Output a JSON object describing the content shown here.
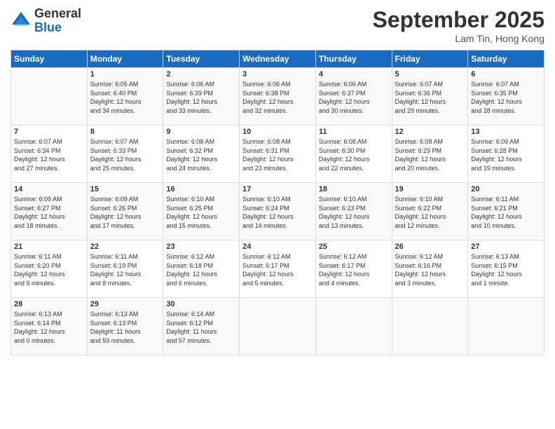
{
  "logo": {
    "general": "General",
    "blue": "Blue"
  },
  "title": "September 2025",
  "location": "Lam Tin, Hong Kong",
  "days_header": [
    "Sunday",
    "Monday",
    "Tuesday",
    "Wednesday",
    "Thursday",
    "Friday",
    "Saturday"
  ],
  "weeks": [
    [
      {
        "day": "",
        "info": ""
      },
      {
        "day": "1",
        "info": "Sunrise: 6:05 AM\nSunset: 6:40 PM\nDaylight: 12 hours\nand 34 minutes."
      },
      {
        "day": "2",
        "info": "Sunrise: 6:06 AM\nSunset: 6:39 PM\nDaylight: 12 hours\nand 33 minutes."
      },
      {
        "day": "3",
        "info": "Sunrise: 6:06 AM\nSunset: 6:38 PM\nDaylight: 12 hours\nand 32 minutes."
      },
      {
        "day": "4",
        "info": "Sunrise: 6:06 AM\nSunset: 6:37 PM\nDaylight: 12 hours\nand 30 minutes."
      },
      {
        "day": "5",
        "info": "Sunrise: 6:07 AM\nSunset: 6:36 PM\nDaylight: 12 hours\nand 29 minutes."
      },
      {
        "day": "6",
        "info": "Sunrise: 6:07 AM\nSunset: 6:35 PM\nDaylight: 12 hours\nand 28 minutes."
      }
    ],
    [
      {
        "day": "7",
        "info": "Sunrise: 6:07 AM\nSunset: 6:34 PM\nDaylight: 12 hours\nand 27 minutes."
      },
      {
        "day": "8",
        "info": "Sunrise: 6:07 AM\nSunset: 6:33 PM\nDaylight: 12 hours\nand 25 minutes."
      },
      {
        "day": "9",
        "info": "Sunrise: 6:08 AM\nSunset: 6:32 PM\nDaylight: 12 hours\nand 24 minutes."
      },
      {
        "day": "10",
        "info": "Sunrise: 6:08 AM\nSunset: 6:31 PM\nDaylight: 12 hours\nand 23 minutes."
      },
      {
        "day": "11",
        "info": "Sunrise: 6:08 AM\nSunset: 6:30 PM\nDaylight: 12 hours\nand 22 minutes."
      },
      {
        "day": "12",
        "info": "Sunrise: 6:08 AM\nSunset: 6:29 PM\nDaylight: 12 hours\nand 20 minutes."
      },
      {
        "day": "13",
        "info": "Sunrise: 6:09 AM\nSunset: 6:28 PM\nDaylight: 12 hours\nand 19 minutes."
      }
    ],
    [
      {
        "day": "14",
        "info": "Sunrise: 6:09 AM\nSunset: 6:27 PM\nDaylight: 12 hours\nand 18 minutes."
      },
      {
        "day": "15",
        "info": "Sunrise: 6:09 AM\nSunset: 6:26 PM\nDaylight: 12 hours\nand 17 minutes."
      },
      {
        "day": "16",
        "info": "Sunrise: 6:10 AM\nSunset: 6:25 PM\nDaylight: 12 hours\nand 15 minutes."
      },
      {
        "day": "17",
        "info": "Sunrise: 6:10 AM\nSunset: 6:24 PM\nDaylight: 12 hours\nand 14 minutes."
      },
      {
        "day": "18",
        "info": "Sunrise: 6:10 AM\nSunset: 6:23 PM\nDaylight: 12 hours\nand 13 minutes."
      },
      {
        "day": "19",
        "info": "Sunrise: 6:10 AM\nSunset: 6:22 PM\nDaylight: 12 hours\nand 12 minutes."
      },
      {
        "day": "20",
        "info": "Sunrise: 6:11 AM\nSunset: 6:21 PM\nDaylight: 12 hours\nand 10 minutes."
      }
    ],
    [
      {
        "day": "21",
        "info": "Sunrise: 6:11 AM\nSunset: 6:20 PM\nDaylight: 12 hours\nand 9 minutes."
      },
      {
        "day": "22",
        "info": "Sunrise: 6:11 AM\nSunset: 6:19 PM\nDaylight: 12 hours\nand 8 minutes."
      },
      {
        "day": "23",
        "info": "Sunrise: 6:12 AM\nSunset: 6:18 PM\nDaylight: 12 hours\nand 6 minutes."
      },
      {
        "day": "24",
        "info": "Sunrise: 6:12 AM\nSunset: 6:17 PM\nDaylight: 12 hours\nand 5 minutes."
      },
      {
        "day": "25",
        "info": "Sunrise: 6:12 AM\nSunset: 6:17 PM\nDaylight: 12 hours\nand 4 minutes."
      },
      {
        "day": "26",
        "info": "Sunrise: 6:12 AM\nSunset: 6:16 PM\nDaylight: 12 hours\nand 3 minutes."
      },
      {
        "day": "27",
        "info": "Sunrise: 6:13 AM\nSunset: 6:15 PM\nDaylight: 12 hours\nand 1 minute."
      }
    ],
    [
      {
        "day": "28",
        "info": "Sunrise: 6:13 AM\nSunset: 6:14 PM\nDaylight: 12 hours\nand 0 minutes."
      },
      {
        "day": "29",
        "info": "Sunrise: 6:13 AM\nSunset: 6:13 PM\nDaylight: 11 hours\nand 59 minutes."
      },
      {
        "day": "30",
        "info": "Sunrise: 6:14 AM\nSunset: 6:12 PM\nDaylight: 11 hours\nand 57 minutes."
      },
      {
        "day": "",
        "info": ""
      },
      {
        "day": "",
        "info": ""
      },
      {
        "day": "",
        "info": ""
      },
      {
        "day": "",
        "info": ""
      }
    ]
  ]
}
